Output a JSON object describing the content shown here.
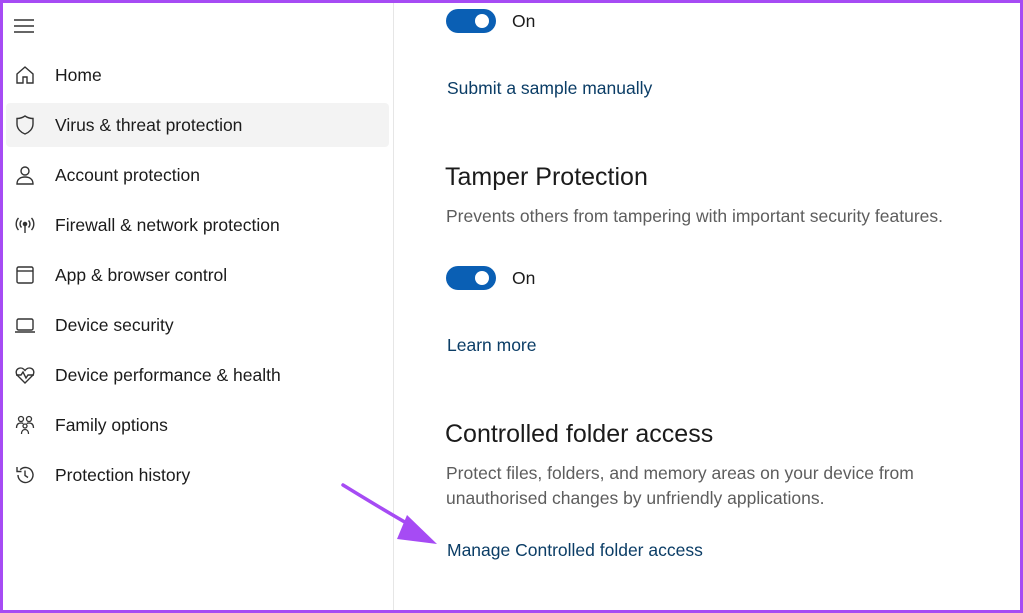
{
  "sidebar": {
    "menu_icon": "hamburger-icon",
    "items": [
      {
        "label": "Home",
        "icon": "home-icon"
      },
      {
        "label": "Virus & threat protection",
        "icon": "shield-icon",
        "active": true
      },
      {
        "label": "Account protection",
        "icon": "person-icon"
      },
      {
        "label": "Firewall & network protection",
        "icon": "wireless-icon"
      },
      {
        "label": "App & browser control",
        "icon": "app-window-icon"
      },
      {
        "label": "Device security",
        "icon": "laptop-icon"
      },
      {
        "label": "Device performance & health",
        "icon": "heart-pulse-icon"
      },
      {
        "label": "Family options",
        "icon": "family-icon"
      },
      {
        "label": "Protection history",
        "icon": "history-icon"
      }
    ]
  },
  "main": {
    "top_toggle": {
      "state_label": "On",
      "on": true
    },
    "submit_link": "Submit a sample manually",
    "tamper": {
      "title": "Tamper Protection",
      "description": "Prevents others from tampering with important security features.",
      "toggle_label": "On",
      "toggle_on": true,
      "learn_more": "Learn more"
    },
    "cfa": {
      "title": "Controlled folder access",
      "description_line1": "Protect files, folders, and memory areas on your device from",
      "description_line2": "unauthorised changes by unfriendly applications.",
      "manage_link": "Manage Controlled folder access"
    }
  },
  "colors": {
    "accent": "#0a5fb4",
    "link": "#0b3d66",
    "arrow": "#a64bf4",
    "frame": "#a64bf4",
    "active_bg": "#f3f3f3"
  }
}
